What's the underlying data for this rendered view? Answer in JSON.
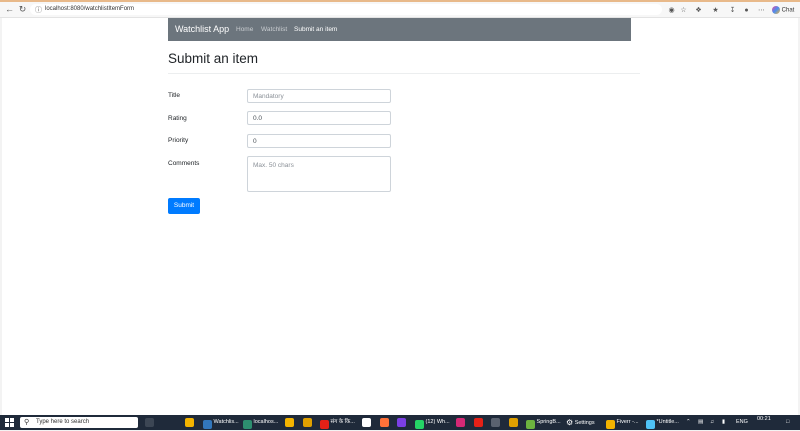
{
  "browser": {
    "url": "localhost:8080/watchlistItemForm",
    "profile_label": "Chat"
  },
  "app": {
    "brand": "Watchlist App",
    "nav": [
      {
        "label": "Home",
        "active": false
      },
      {
        "label": "Watchlist",
        "active": false
      },
      {
        "label": "Submit an item",
        "active": true
      }
    ]
  },
  "form": {
    "title": "Submit an item",
    "fields": {
      "title": {
        "label": "Title",
        "value": "",
        "placeholder": "Mandatory"
      },
      "rating": {
        "label": "Rating",
        "value": "0.0",
        "placeholder": ""
      },
      "priority": {
        "label": "Priority",
        "value": "0",
        "placeholder": ""
      },
      "comments": {
        "label": "Comments",
        "value": "",
        "placeholder": "Max. 50 chars"
      }
    },
    "submit_label": "Submit"
  },
  "taskbar": {
    "search_placeholder": "Type here to search",
    "items": [
      "Watchlis...",
      "localhos...",
      "संग के कि...",
      "(12) Wh...",
      "SpringB...",
      "Settings",
      "Fiverr -...",
      "*Untitle..."
    ],
    "lang": "ENG",
    "time": "00:21"
  },
  "colors": {
    "navbar_bg": "#6c757d",
    "primary": "#007bff",
    "taskbar_bg": "#1f2a3a"
  }
}
